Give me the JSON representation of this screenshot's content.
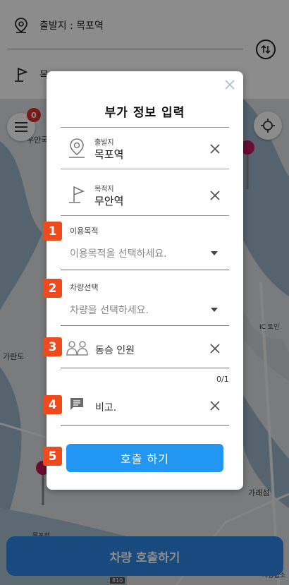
{
  "route": {
    "start_text": "출발지 : 목포역",
    "dest_text": "목",
    "start_icon": "location-pin-icon",
    "dest_icon": "flag-icon",
    "swap_icon": "swap-vertical-icon"
  },
  "map": {
    "labels": [
      "우안국",
      "가란도",
      "IC 토인",
      "가래섬",
      "목포항",
      "시영업소",
      "810"
    ],
    "menu_badge": "0"
  },
  "bottom_button": {
    "label": "차량 호출하기"
  },
  "modal": {
    "title": "부가 정보 입력",
    "origin": {
      "label": "출발지",
      "value": "목포역"
    },
    "destination": {
      "label": "목적지",
      "value": "무안역"
    },
    "purpose": {
      "label": "이용목적",
      "placeholder": "이용목적을 선택하세요."
    },
    "vehicle": {
      "label": "차량선택",
      "placeholder": "차량을  선택하세요."
    },
    "companions": {
      "label": "동승 인원"
    },
    "counter": "0/1",
    "note": {
      "label": "비고."
    },
    "call_button": "호출 하기"
  },
  "step_badges": [
    "1",
    "2",
    "3",
    "4",
    "5"
  ],
  "colors": {
    "badge": "#f04a1c",
    "primary": "#2196f3",
    "bottom_button": "#2f88e3",
    "notification": "#d9312b"
  }
}
